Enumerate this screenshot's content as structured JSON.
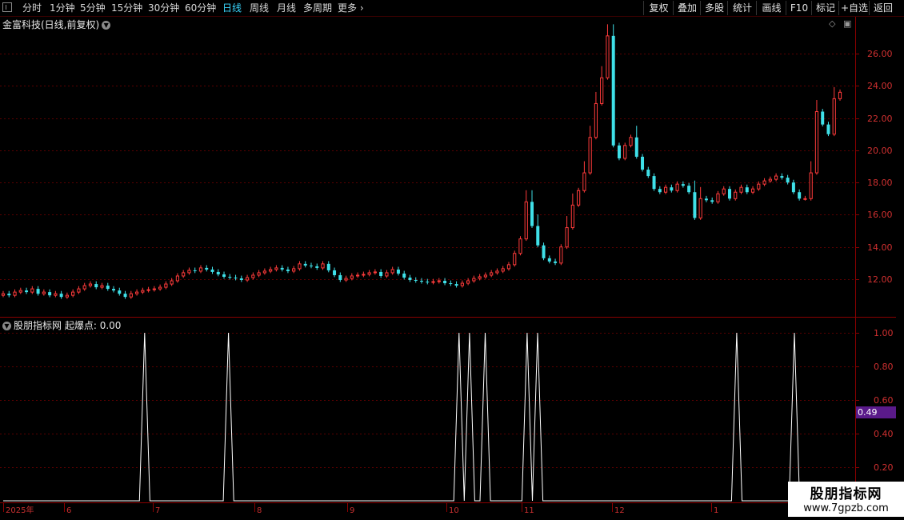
{
  "toolbar": {
    "periods": [
      "分时",
      "1分钟",
      "5分钟",
      "15分钟",
      "30分钟",
      "60分钟",
      "日线",
      "周线",
      "月线",
      "多周期",
      "更多"
    ],
    "active_period": "日线",
    "right_buttons": [
      "复权",
      "叠加",
      "多股",
      "统计",
      "画线",
      "F10",
      "标记",
      "+自选",
      "返回"
    ]
  },
  "stock": {
    "title": "金富科技(日线,前复权)"
  },
  "indicator": {
    "label": "股朋指标网",
    "name": "起爆点",
    "value": "0.00",
    "badge_value": "0.49"
  },
  "price_axis": [
    "26.00",
    "24.00",
    "22.00",
    "20.00",
    "18.00",
    "16.00",
    "14.00",
    "12.00"
  ],
  "indicator_axis": [
    "1.00",
    "0.80",
    "0.60",
    "0.40",
    "0.20"
  ],
  "date_axis": [
    "2025年",
    "6",
    "7",
    "8",
    "9",
    "10",
    "11",
    "12",
    "1"
  ],
  "watermark": {
    "name": "股朋指标网",
    "url": "www.7gpzb.com"
  },
  "colors": {
    "up": "#ff3b3b",
    "down": "#3fe0e8",
    "grid": "#5a0000",
    "axis_text": "#d03030",
    "highlight": "#5a1a8a"
  },
  "chart_data": [
    {
      "type": "candlestick",
      "title": "金富科技(日线,前复权)",
      "y_ticks": [
        12,
        14,
        16,
        18,
        20,
        22,
        24,
        26
      ],
      "x_ticks": [
        "2025年",
        "6",
        "7",
        "8",
        "9",
        "10",
        "11",
        "12",
        "1"
      ],
      "close": [
        11.1,
        11.0,
        11.2,
        11.3,
        11.2,
        11.4,
        11.1,
        11.2,
        11.0,
        11.1,
        10.9,
        11.0,
        11.2,
        11.4,
        11.6,
        11.7,
        11.5,
        11.6,
        11.4,
        11.3,
        11.1,
        10.9,
        11.1,
        11.2,
        11.3,
        11.35,
        11.4,
        11.5,
        11.7,
        11.9,
        12.2,
        12.4,
        12.55,
        12.5,
        12.7,
        12.6,
        12.45,
        12.3,
        12.15,
        12.1,
        12.05,
        11.95,
        12.1,
        12.25,
        12.4,
        12.5,
        12.6,
        12.7,
        12.6,
        12.5,
        12.65,
        12.95,
        12.85,
        12.8,
        12.7,
        12.95,
        12.55,
        12.25,
        11.95,
        12.05,
        12.2,
        12.25,
        12.3,
        12.4,
        12.45,
        12.2,
        12.4,
        12.6,
        12.35,
        12.1,
        11.95,
        11.9,
        11.85,
        11.8,
        11.85,
        11.9,
        11.75,
        11.7,
        11.6,
        11.75,
        11.9,
        12.05,
        12.15,
        12.25,
        12.4,
        12.5,
        12.65,
        12.9,
        13.6,
        14.5,
        16.8,
        15.3,
        14.1,
        13.3,
        13.1,
        13.0,
        14.0,
        15.2,
        16.6,
        17.5,
        18.6,
        20.8,
        22.9,
        24.5,
        27.1,
        20.3,
        19.5,
        20.3,
        20.8,
        19.6,
        18.8,
        18.4,
        17.6,
        17.4,
        17.7,
        17.5,
        17.9,
        17.8,
        17.4,
        15.8,
        17.0,
        16.9,
        16.8,
        17.3,
        17.6,
        17.0,
        17.4,
        17.7,
        17.4,
        17.6,
        17.9,
        18.1,
        18.2,
        18.4,
        18.3,
        18.0,
        17.4,
        17.0,
        17.0,
        18.6,
        22.4,
        21.6,
        21.0,
        23.2,
        23.6
      ],
      "x_range": [
        0,
        144
      ],
      "y_range": [
        10.6,
        27.8
      ]
    },
    {
      "type": "line",
      "title": "起爆点",
      "y_ticks": [
        0.2,
        0.4,
        0.6,
        0.8,
        1.0
      ],
      "y_range": [
        0,
        1.03
      ],
      "signal_days": [
        27,
        43,
        87,
        89,
        92,
        100,
        102,
        140,
        151
      ],
      "x_range": [
        0,
        162
      ]
    }
  ]
}
